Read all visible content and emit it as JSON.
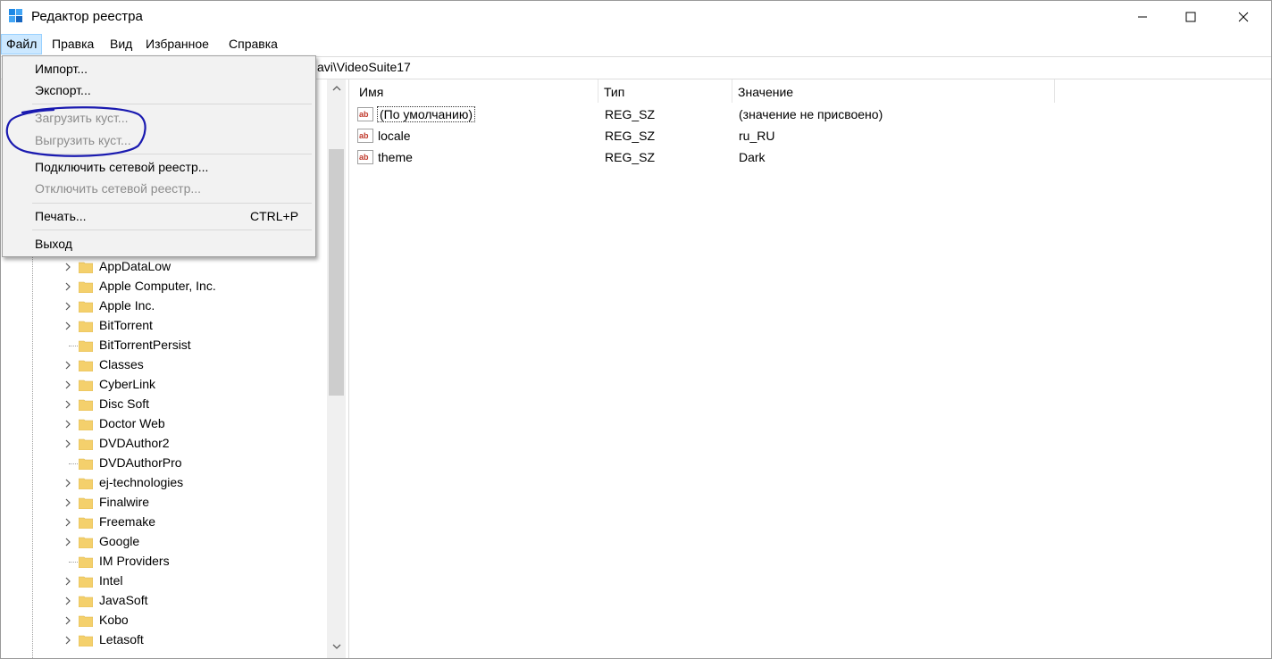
{
  "window": {
    "title": "Редактор реестра"
  },
  "menubar": {
    "items": [
      "Файл",
      "Правка",
      "Вид",
      "Избранное",
      "Справка"
    ]
  },
  "address": {
    "path_visible": "avi\\VideoSuite17"
  },
  "file_menu": {
    "import": "Импорт...",
    "export": "Экспорт...",
    "load_hive": "Загрузить куст...",
    "unload_hive": "Выгрузить куст...",
    "connect_network": "Подключить сетевой реестр...",
    "disconnect_network": "Отключить сетевой реестр...",
    "print": "Печать...",
    "print_shortcut": "CTRL+P",
    "exit": "Выход"
  },
  "tree": {
    "items": [
      {
        "label": "AppDataLow",
        "expandable": true
      },
      {
        "label": "Apple Computer, Inc.",
        "expandable": true
      },
      {
        "label": "Apple Inc.",
        "expandable": true
      },
      {
        "label": "BitTorrent",
        "expandable": true
      },
      {
        "label": "BitTorrentPersist",
        "expandable": false
      },
      {
        "label": "Classes",
        "expandable": true
      },
      {
        "label": "CyberLink",
        "expandable": true
      },
      {
        "label": "Disc Soft",
        "expandable": true
      },
      {
        "label": "Doctor Web",
        "expandable": true
      },
      {
        "label": "DVDAuthor2",
        "expandable": true
      },
      {
        "label": "DVDAuthorPro",
        "expandable": false
      },
      {
        "label": "ej-technologies",
        "expandable": true
      },
      {
        "label": "Finalwire",
        "expandable": true
      },
      {
        "label": "Freemake",
        "expandable": true
      },
      {
        "label": "Google",
        "expandable": true
      },
      {
        "label": "IM Providers",
        "expandable": false
      },
      {
        "label": "Intel",
        "expandable": true
      },
      {
        "label": "JavaSoft",
        "expandable": true
      },
      {
        "label": "Kobo",
        "expandable": true
      },
      {
        "label": "Letasoft",
        "expandable": true
      }
    ]
  },
  "list": {
    "columns": [
      "Имя",
      "Тип",
      "Значение"
    ],
    "rows": [
      {
        "name": "(По умолчанию)",
        "type": "REG_SZ",
        "value": "(значение не присвоено)"
      },
      {
        "name": "locale",
        "type": "REG_SZ",
        "value": "ru_RU"
      },
      {
        "name": "theme",
        "type": "REG_SZ",
        "value": "Dark"
      }
    ]
  },
  "colors": {
    "menu_highlight": "#cce8ff",
    "annotation": "#1a1ab0",
    "folder": "#f4d06c",
    "string_icon": "#c0392b"
  }
}
